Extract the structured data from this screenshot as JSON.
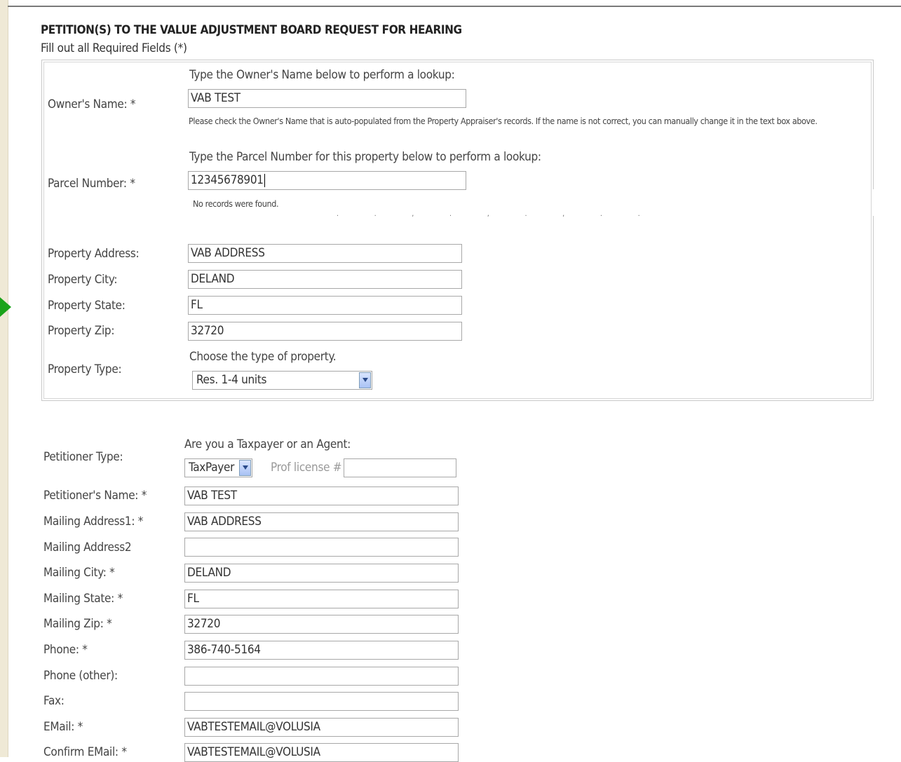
{
  "form": {
    "title": "PETITION(S) TO THE VALUE ADJUSTMENT BOARD REQUEST FOR HEARING",
    "subtitle": "Fill out all Required Fields (*)"
  },
  "property": {
    "owner_label": "Owner's Name: *",
    "owner_hint": "Type the Owner's Name below to perform a lookup:",
    "owner_value": "VAB TEST",
    "owner_note": "Please check the Owner's Name that is auto-populated from the Property Appraiser's records. If the name is not correct, you can manually change it in the text box above.",
    "parcel_label": "Parcel Number: *",
    "parcel_hint": "Type the Parcel Number for this property below to perform a lookup:",
    "parcel_value": "12345678901",
    "parcel_note": "No records were found.",
    "dots": ". . , . , . , . .",
    "address_label": "Property Address:",
    "address_value": "VAB ADDRESS",
    "city_label": "Property City:",
    "city_value": "DELAND",
    "state_label": "Property State:",
    "state_value": "FL",
    "zip_label": "Property Zip:",
    "zip_value": "32720",
    "type_label": "Property Type:",
    "type_hint": "Choose the type of property.",
    "type_value": "Res. 1-4 units"
  },
  "petitioner": {
    "type_label": "Petitioner Type:",
    "type_hint": "Are you a Taxpayer or an Agent:",
    "type_value": "TaxPayer",
    "license_label": "Prof license #",
    "license_value": "",
    "name_label": "Petitioner's Name: *",
    "name_value": "VAB TEST",
    "addr1_label": "Mailing Address1: *",
    "addr1_value": "VAB ADDRESS",
    "addr2_label": "Mailing Address2",
    "addr2_value": "",
    "city_label": "Mailing City: *",
    "city_value": "DELAND",
    "state_label": "Mailing State: *",
    "state_value": "FL",
    "zip_label": "Mailing Zip: *",
    "zip_value": "32720",
    "phone_label": "Phone: *",
    "phone_value": "386-740-5164",
    "phone2_label": "Phone (other):",
    "phone2_value": "",
    "fax_label": "Fax:",
    "fax_value": "",
    "email_label": "EMail: *",
    "email_value": "VABTESTEMAIL@VOLUSIA",
    "email2_label": "Confirm EMail: *",
    "email2_value": "VABTESTEMAIL@VOLUSIA"
  },
  "colors": {
    "arrow": "#1aa31a",
    "strip": "#efe9d6"
  }
}
